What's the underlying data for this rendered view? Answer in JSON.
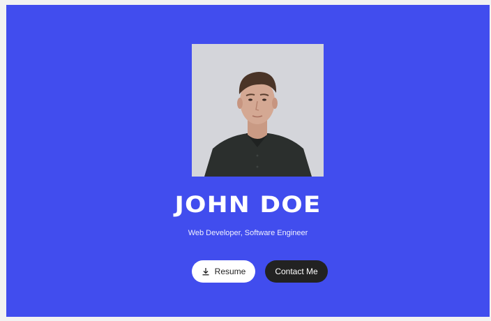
{
  "profile": {
    "name": "JOHN DOE",
    "subtitle": "Web Developer, Software Engineer",
    "photo_alt": "Portrait of John Doe"
  },
  "actions": {
    "resume_label": "Resume",
    "resume_icon": "download-icon",
    "contact_label": "Contact Me"
  },
  "colors": {
    "hero_background": "#414dee",
    "resume_button": "#ffffff",
    "contact_button": "#222222"
  }
}
